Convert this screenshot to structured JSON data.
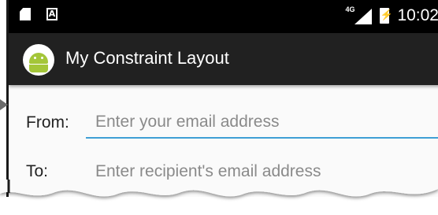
{
  "status_bar": {
    "network_type": "4G",
    "time": "10:02",
    "icons": [
      "sd-card-icon",
      "a-notification-icon",
      "signal-icon",
      "battery-icon"
    ]
  },
  "app_bar": {
    "title": "My Constraint Layout",
    "logo_icon": "android-logo-icon"
  },
  "form": {
    "from": {
      "label": "From:",
      "value": "",
      "placeholder": "Enter your email address"
    },
    "to": {
      "label": "To:",
      "value": "",
      "placeholder": "Enter recipient's email address"
    }
  },
  "colors": {
    "status_bar_bg": "#000000",
    "app_bar_bg": "#212121",
    "content_bg": "#fafafa",
    "focused_underline": "#3f9fd5",
    "android_green": "#a4c639"
  }
}
